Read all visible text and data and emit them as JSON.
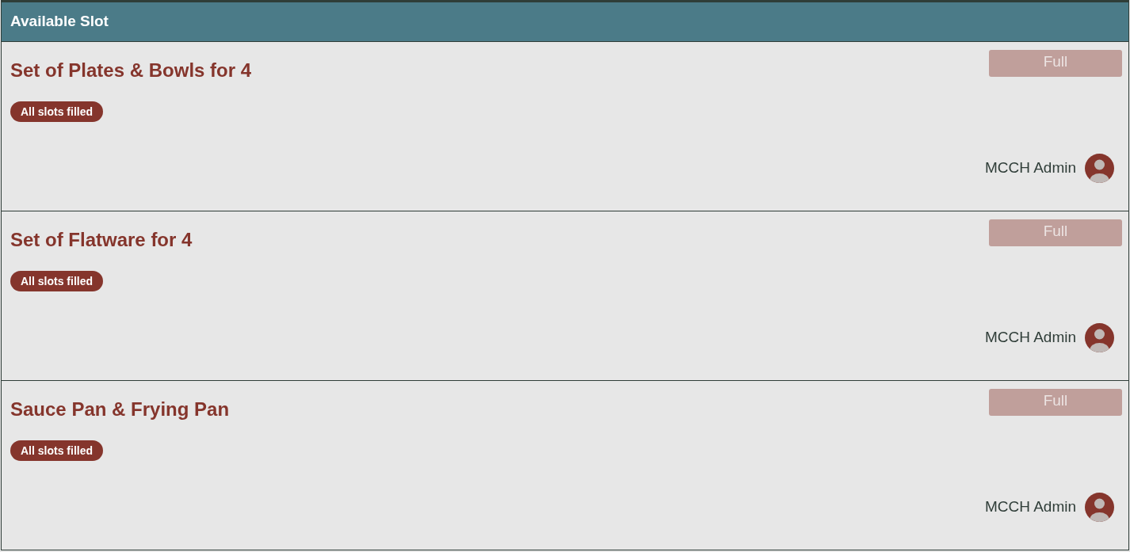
{
  "header": {
    "title": "Available Slot"
  },
  "slots": [
    {
      "title": "Set of Plates & Bowls for 4",
      "badge": "All slots filled",
      "button": {
        "label": "Full",
        "disabled": true
      },
      "owner": "MCCH Admin"
    },
    {
      "title": "Set of Flatware for 4",
      "badge": "All slots filled",
      "button": {
        "label": "Full",
        "disabled": true
      },
      "owner": "MCCH Admin"
    },
    {
      "title": "Sauce Pan & Frying Pan",
      "badge": "All slots filled",
      "button": {
        "label": "Full",
        "disabled": true
      },
      "owner": "MCCH Admin"
    }
  ]
}
